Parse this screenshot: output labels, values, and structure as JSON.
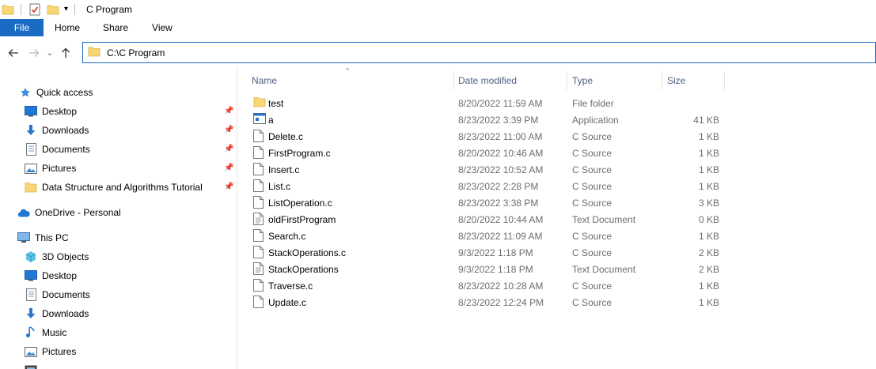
{
  "window": {
    "title": "C Program"
  },
  "ribbon": {
    "tabs": [
      "File",
      "Home",
      "Share",
      "View"
    ]
  },
  "address": {
    "path": "C:\\C Program"
  },
  "columns": {
    "name": "Name",
    "date": "Date modified",
    "type": "Type",
    "size": "Size"
  },
  "nav": {
    "quick_access": "Quick access",
    "qa_items": [
      {
        "label": "Desktop",
        "icon": "desktop-icon"
      },
      {
        "label": "Downloads",
        "icon": "downloads-icon"
      },
      {
        "label": "Documents",
        "icon": "documents-icon"
      },
      {
        "label": "Pictures",
        "icon": "pictures-icon"
      },
      {
        "label": "Data Structure and Algorithms Tutorial",
        "icon": "folder-icon"
      }
    ],
    "onedrive": "OneDrive - Personal",
    "this_pc": "This PC",
    "pc_items": [
      {
        "label": "3D Objects",
        "icon": "3d-objects-icon"
      },
      {
        "label": "Desktop",
        "icon": "desktop-icon"
      },
      {
        "label": "Documents",
        "icon": "documents-icon"
      },
      {
        "label": "Downloads",
        "icon": "downloads-icon"
      },
      {
        "label": "Music",
        "icon": "music-icon"
      },
      {
        "label": "Pictures",
        "icon": "pictures-icon"
      }
    ]
  },
  "files": [
    {
      "name": "test",
      "date": "8/20/2022 11:59 AM",
      "type": "File folder",
      "size": "",
      "icon": "folder-icon"
    },
    {
      "name": "a",
      "date": "8/23/2022 3:39 PM",
      "type": "Application",
      "size": "41 KB",
      "icon": "application-icon"
    },
    {
      "name": "Delete.c",
      "date": "8/23/2022 11:00 AM",
      "type": "C Source",
      "size": "1 KB",
      "icon": "file-icon"
    },
    {
      "name": "FirstProgram.c",
      "date": "8/20/2022 10:46 AM",
      "type": "C Source",
      "size": "1 KB",
      "icon": "file-icon"
    },
    {
      "name": "Insert.c",
      "date": "8/23/2022 10:52 AM",
      "type": "C Source",
      "size": "1 KB",
      "icon": "file-icon"
    },
    {
      "name": "List.c",
      "date": "8/23/2022 2:28 PM",
      "type": "C Source",
      "size": "1 KB",
      "icon": "file-icon"
    },
    {
      "name": "ListOperation.c",
      "date": "8/23/2022 3:38 PM",
      "type": "C Source",
      "size": "3 KB",
      "icon": "file-icon"
    },
    {
      "name": "oldFirstProgram",
      "date": "8/20/2022 10:44 AM",
      "type": "Text Document",
      "size": "0 KB",
      "icon": "text-document-icon"
    },
    {
      "name": "Search.c",
      "date": "8/23/2022 11:09 AM",
      "type": "C Source",
      "size": "1 KB",
      "icon": "file-icon"
    },
    {
      "name": "StackOperations.c",
      "date": "9/3/2022 1:18 PM",
      "type": "C Source",
      "size": "2 KB",
      "icon": "file-icon"
    },
    {
      "name": "StackOperations",
      "date": "9/3/2022 1:18 PM",
      "type": "Text Document",
      "size": "2 KB",
      "icon": "text-document-icon"
    },
    {
      "name": "Traverse.c",
      "date": "8/23/2022 10:28 AM",
      "type": "C Source",
      "size": "1 KB",
      "icon": "file-icon"
    },
    {
      "name": "Update.c",
      "date": "8/23/2022 12:24 PM",
      "type": "C Source",
      "size": "1 KB",
      "icon": "file-icon"
    }
  ],
  "colors": {
    "accent": "#1a6bc4",
    "folder": "#f7d774",
    "header_text": "#4d6082",
    "secondary_text": "#6d6d6d"
  }
}
